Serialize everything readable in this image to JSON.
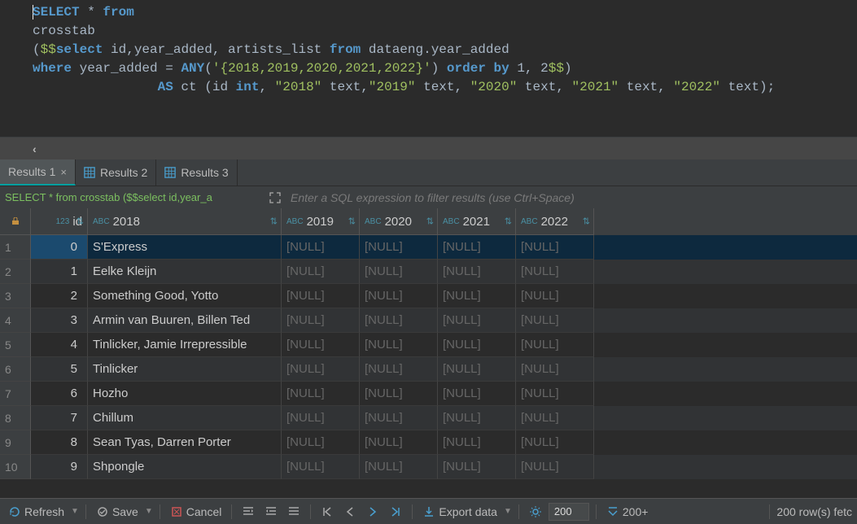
{
  "editor": {
    "line1_kw1": "SELECT",
    "line1_star": " * ",
    "line1_kw2": "from",
    "line2": "crosstab",
    "line3_open": "(",
    "line3_dd": "$$",
    "line3_kw": "select",
    "line3_rest": " id,year_added, artists_list ",
    "line3_from": "from",
    "line3_tbl": " dataeng.year_added",
    "line4_where": "where",
    "line4_col": " year_added = ",
    "line4_any": "ANY",
    "line4_p": "(",
    "line4_str": "'{2018,2019,2020,2021,2022}'",
    "line4_p2": ") ",
    "line4_order": "order by",
    "line4_ob": " 1, 2",
    "line4_dd": "$$",
    "line4_close": ")",
    "line5_pre": "                ",
    "line5_as": "AS",
    "line5_ct": " ct (id ",
    "line5_int": "int",
    "line5_c1": ", ",
    "line5_q2018": "\"2018\"",
    "line5_t1": " text,",
    "line5_q2019": "\"2019\"",
    "line5_t2": " text, ",
    "line5_q2020": "\"2020\"",
    "line5_t3": " text, ",
    "line5_q2021": "\"2021\"",
    "line5_t4": " text, ",
    "line5_q2022": "\"2022\"",
    "line5_t5": " text);"
  },
  "back_arrow": "‹",
  "tabs": [
    {
      "label": "Results 1",
      "active": true,
      "close": "×"
    },
    {
      "label": "Results 2",
      "active": false
    },
    {
      "label": "Results 3",
      "active": false
    }
  ],
  "sql_preview": "SELECT * from crosstab ($$select id,year_a",
  "filter_placeholder": "Enter a SQL expression to filter results (use Ctrl+Space)",
  "columns": {
    "id": {
      "label": "id",
      "type": "123"
    },
    "c2018": {
      "label": "2018",
      "type": "ABC"
    },
    "c2019": {
      "label": "2019",
      "type": "ABC"
    },
    "c2020": {
      "label": "2020",
      "type": "ABC"
    },
    "c2021": {
      "label": "2021",
      "type": "ABC"
    },
    "c2022": {
      "label": "2022",
      "type": "ABC"
    }
  },
  "rows": [
    {
      "n": "1",
      "id": "0",
      "c2018": "S'Express",
      "c2019": "[NULL]",
      "c2020": "[NULL]",
      "c2021": "[NULL]",
      "c2022": "[NULL]"
    },
    {
      "n": "2",
      "id": "1",
      "c2018": "Eelke Kleijn",
      "c2019": "[NULL]",
      "c2020": "[NULL]",
      "c2021": "[NULL]",
      "c2022": "[NULL]"
    },
    {
      "n": "3",
      "id": "2",
      "c2018": "Something Good, Yotto",
      "c2019": "[NULL]",
      "c2020": "[NULL]",
      "c2021": "[NULL]",
      "c2022": "[NULL]"
    },
    {
      "n": "4",
      "id": "3",
      "c2018": "Armin van Buuren, Billen Ted",
      "c2019": "[NULL]",
      "c2020": "[NULL]",
      "c2021": "[NULL]",
      "c2022": "[NULL]"
    },
    {
      "n": "5",
      "id": "4",
      "c2018": "Tinlicker, Jamie Irrepressible",
      "c2019": "[NULL]",
      "c2020": "[NULL]",
      "c2021": "[NULL]",
      "c2022": "[NULL]"
    },
    {
      "n": "6",
      "id": "5",
      "c2018": "Tinlicker",
      "c2019": "[NULL]",
      "c2020": "[NULL]",
      "c2021": "[NULL]",
      "c2022": "[NULL]"
    },
    {
      "n": "7",
      "id": "6",
      "c2018": "Hozho",
      "c2019": "[NULL]",
      "c2020": "[NULL]",
      "c2021": "[NULL]",
      "c2022": "[NULL]"
    },
    {
      "n": "8",
      "id": "7",
      "c2018": "Chillum",
      "c2019": "[NULL]",
      "c2020": "[NULL]",
      "c2021": "[NULL]",
      "c2022": "[NULL]"
    },
    {
      "n": "9",
      "id": "8",
      "c2018": "Sean Tyas, Darren Porter",
      "c2019": "[NULL]",
      "c2020": "[NULL]",
      "c2021": "[NULL]",
      "c2022": "[NULL]"
    },
    {
      "n": "10",
      "id": "9",
      "c2018": "Shpongle",
      "c2019": "[NULL]",
      "c2020": "[NULL]",
      "c2021": "[NULL]",
      "c2022": "[NULL]"
    }
  ],
  "status": {
    "refresh": "Refresh",
    "save": "Save",
    "cancel": "Cancel",
    "export": "Export data",
    "page_size": "200",
    "page_count": "200+",
    "rowcount": "200 row(s) fetc"
  }
}
